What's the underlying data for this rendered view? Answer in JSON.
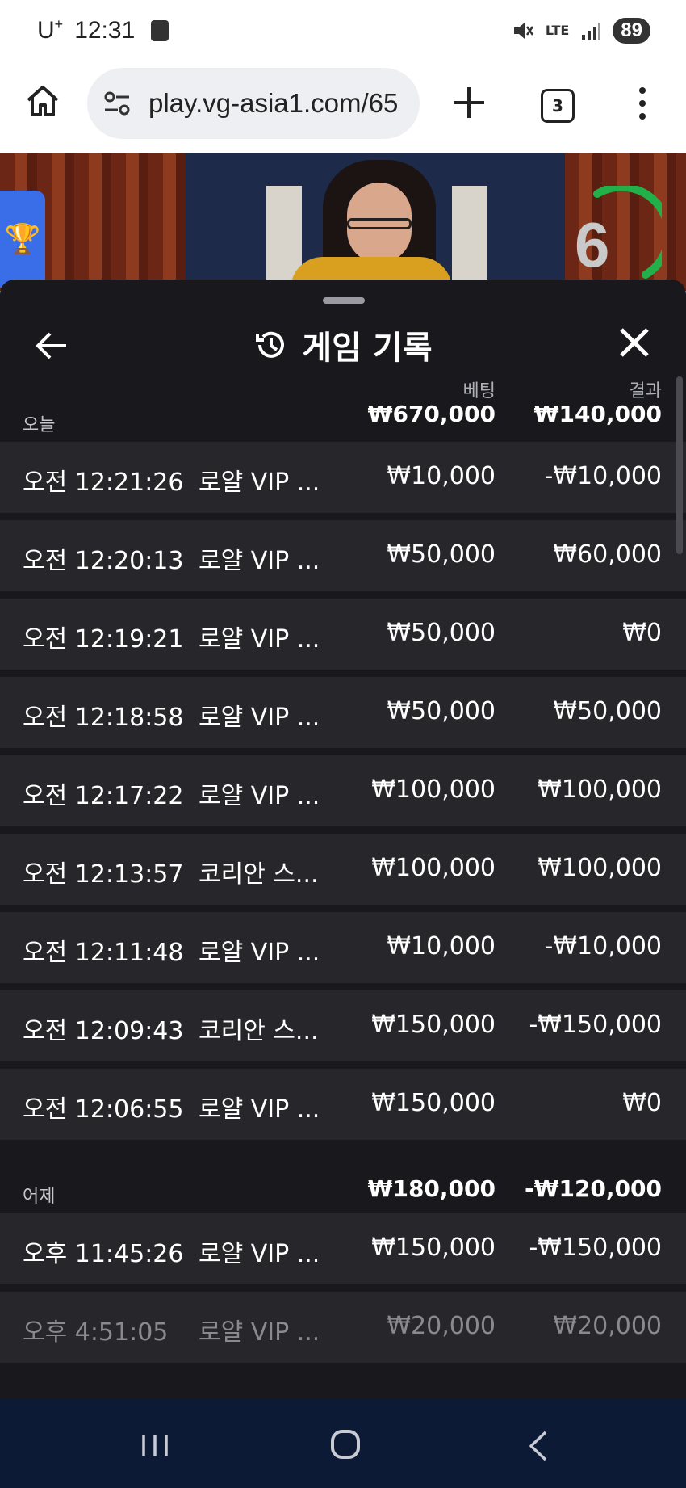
{
  "status_bar": {
    "carrier": "U",
    "carrier_sup": "+",
    "time": "12:31",
    "network": "LTE",
    "battery": "89"
  },
  "browser": {
    "url": "play.vg-asia1.com/65",
    "tab_count": "3"
  },
  "video": {
    "timer": "6"
  },
  "sheet": {
    "title": "게임 기록",
    "col_bet": "베팅",
    "col_result": "결과",
    "groups": [
      {
        "name": "오늘",
        "bet_total": "₩670,000",
        "result_total": "₩140,000",
        "rows": [
          {
            "time": "오전 12:21:26",
            "game": "로얄 VIP ...",
            "bet": "₩10,000",
            "result": "-₩10,000"
          },
          {
            "time": "오전 12:20:13",
            "game": "로얄 VIP ...",
            "bet": "₩50,000",
            "result": "₩60,000"
          },
          {
            "time": "오전 12:19:21",
            "game": "로얄 VIP ...",
            "bet": "₩50,000",
            "result": "₩0"
          },
          {
            "time": "오전 12:18:58",
            "game": "로얄 VIP ...",
            "bet": "₩50,000",
            "result": "₩50,000"
          },
          {
            "time": "오전 12:17:22",
            "game": "로얄 VIP ...",
            "bet": "₩100,000",
            "result": "₩100,000"
          },
          {
            "time": "오전 12:13:57",
            "game": "코리안 스...",
            "bet": "₩100,000",
            "result": "₩100,000"
          },
          {
            "time": "오전 12:11:48",
            "game": "로얄 VIP ...",
            "bet": "₩10,000",
            "result": "-₩10,000"
          },
          {
            "time": "오전 12:09:43",
            "game": "코리안 스...",
            "bet": "₩150,000",
            "result": "-₩150,000"
          },
          {
            "time": "오전 12:06:55",
            "game": "로얄 VIP ...",
            "bet": "₩150,000",
            "result": "₩0"
          }
        ]
      },
      {
        "name": "어제",
        "bet_total": "₩180,000",
        "result_total": "-₩120,000",
        "rows": [
          {
            "time": "오후 11:45:26",
            "game": "로얄 VIP ...",
            "bet": "₩150,000",
            "result": "-₩150,000"
          },
          {
            "time": "오후 4:51:05",
            "game": "로얄 VIP ...",
            "bet": "₩20,000",
            "result": "₩20,000"
          }
        ]
      }
    ]
  },
  "colors": {
    "sheet_bg": "#19191d",
    "row_bg": "#27272b",
    "timer_ring": "#22b04a",
    "nav_bg": "#0c1a36"
  }
}
